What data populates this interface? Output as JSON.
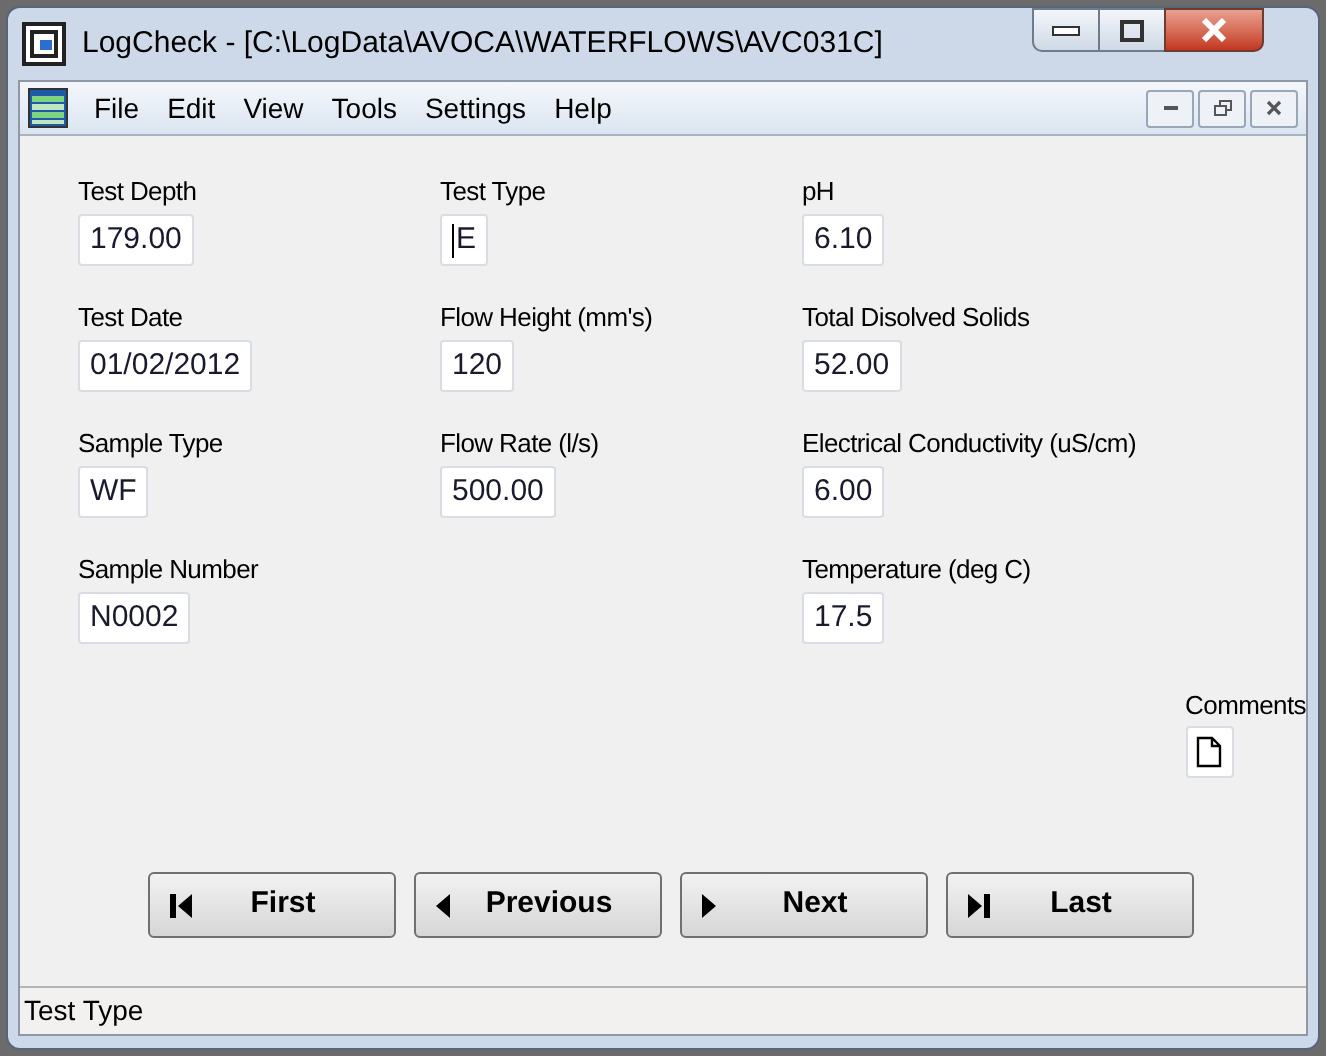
{
  "window": {
    "title": "LogCheck - [C:\\LogData\\AVOCA\\WATERFLOWS\\AVC031C]"
  },
  "menu": [
    "File",
    "Edit",
    "View",
    "Tools",
    "Settings",
    "Help"
  ],
  "columns": [
    [
      {
        "label": "Test Depth",
        "value": "179.00",
        "focused": false
      },
      {
        "label": "Test Date",
        "value": "01/02/2012",
        "focused": false
      },
      {
        "label": "Sample Type",
        "value": "WF",
        "focused": false
      },
      {
        "label": "Sample Number",
        "value": "N0002",
        "focused": false
      }
    ],
    [
      {
        "label": "Test Type",
        "value": "E",
        "focused": true
      },
      {
        "label": "Flow Height (mm's)",
        "value": "120",
        "focused": false
      },
      {
        "label": "Flow Rate (l/s)",
        "value": "500.00",
        "focused": false
      }
    ],
    [
      {
        "label": "pH",
        "value": "6.10",
        "focused": false
      },
      {
        "label": "Total Disolved Solids",
        "value": "52.00",
        "focused": false
      },
      {
        "label": "Electrical Conductivity (uS/cm)",
        "value": "6.00",
        "focused": false
      },
      {
        "label": "Temperature (deg C)",
        "value": "17.5",
        "focused": false
      }
    ]
  ],
  "comments": {
    "label": "Comments"
  },
  "nav_buttons": [
    {
      "kind": "first",
      "label": "First"
    },
    {
      "kind": "previous",
      "label": "Previous"
    },
    {
      "kind": "next",
      "label": "Next"
    },
    {
      "kind": "last",
      "label": "Last"
    }
  ],
  "status_bar": "Test Type"
}
